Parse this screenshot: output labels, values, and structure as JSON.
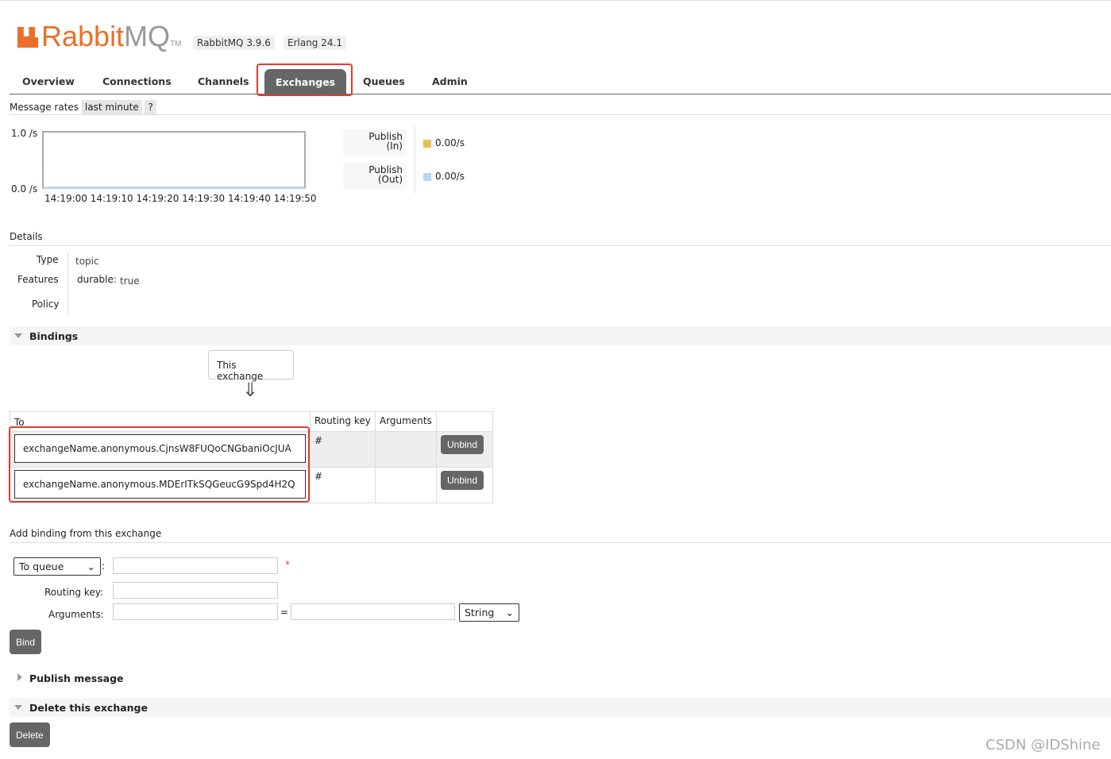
{
  "header": {
    "logo_main": "Rabbit",
    "logo_mq": "MQ",
    "logo_tm": "TM",
    "version": "RabbitMQ 3.9.6",
    "erlang": "Erlang 24.1"
  },
  "nav": {
    "tabs": [
      {
        "label": "Overview"
      },
      {
        "label": "Connections"
      },
      {
        "label": "Channels"
      },
      {
        "label": "Exchanges",
        "active": true
      },
      {
        "label": "Queues"
      },
      {
        "label": "Admin"
      }
    ]
  },
  "rates": {
    "title": "Message rates",
    "range": "last minute",
    "help": "?",
    "y_max": "1.0 /s",
    "y_min": "0.0 /s",
    "x_ticks": [
      "14:19:00",
      "14:19:10",
      "14:19:20",
      "14:19:30",
      "14:19:40",
      "14:19:50"
    ],
    "legend": [
      {
        "label1": "Publish",
        "label2": "(In)",
        "value": "0.00/s",
        "color": "#e8c057"
      },
      {
        "label1": "Publish",
        "label2": "(Out)",
        "value": "0.00/s",
        "color": "#b8d6f2"
      }
    ]
  },
  "details": {
    "title": "Details",
    "type_label": "Type",
    "type_value": "topic",
    "features_label": "Features",
    "features_key": "durable:",
    "features_value": "true",
    "policy_label": "Policy"
  },
  "bindings": {
    "title": "Bindings",
    "this_exchange": "This exchange",
    "arrow": "⇓",
    "headers": [
      "To",
      "Routing key",
      "Arguments"
    ],
    "rows": [
      {
        "to": "exchangeName.anonymous.CjnsW8FUQoCNGbaniOcJUA",
        "key": "#",
        "args": "",
        "action": "Unbind"
      },
      {
        "to": "exchangeName.anonymous.MDErITkSQGeucG9Spd4H2Q",
        "key": "#",
        "args": "",
        "action": "Unbind"
      }
    ]
  },
  "add_binding": {
    "title": "Add binding from this exchange",
    "dest_type": "To queue",
    "colon": ":",
    "required": "*",
    "routing_label": "Routing key:",
    "args_label": "Arguments:",
    "eq": "=",
    "arg_type": "String",
    "bind": "Bind"
  },
  "publish": {
    "title": "Publish message"
  },
  "delete": {
    "title": "Delete this exchange",
    "button": "Delete"
  },
  "watermark": "CSDN @IDShine",
  "colors": {
    "brand": "#e96f2a",
    "highlight": "#e33b2e",
    "tab_active": "#666666"
  }
}
